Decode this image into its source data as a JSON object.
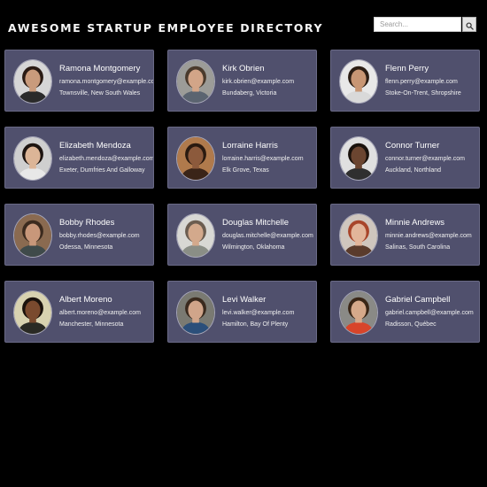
{
  "header": {
    "title": "Awesome Startup Employee Directory"
  },
  "search": {
    "placeholder": "Search...",
    "value": "",
    "icon": "search-icon"
  },
  "employees": [
    {
      "name": "Ramona Montgomery",
      "email": "ramona.montgomery@example.com",
      "location": "Townsville, New South Wales",
      "skin": "#c99b7c",
      "hair": "#2a1b14",
      "bg": "#d6d6d6",
      "shirt": "#2a2a2a"
    },
    {
      "name": "Kirk Obrien",
      "email": "kirk.obrien@example.com",
      "location": "Bundaberg, Victoria",
      "skin": "#d2a588",
      "hair": "#4a3a2c",
      "bg": "#9c9c98",
      "shirt": "#5b6470"
    },
    {
      "name": "Flenn Perry",
      "email": "flenn.perry@example.com",
      "location": "Stoke-On-Trent, Shropshire",
      "skin": "#c89674",
      "hair": "#2b1d14",
      "bg": "#e8e8e8",
      "shirt": "#d9d9d9"
    },
    {
      "name": "Elizabeth Mendoza",
      "email": "elizabeth.mendoza@example.com",
      "location": "Exeter, Dumfries And Galloway",
      "skin": "#dcb597",
      "hair": "#1d1410",
      "bg": "#cfcfcf",
      "shirt": "#e8e8e8"
    },
    {
      "name": "Lorraine Harris",
      "email": "lorraine.harris@example.com",
      "location": "Elk Grove, Texas",
      "skin": "#8c5a3c",
      "hair": "#2a1a10",
      "bg": "#b07a4c",
      "shirt": "#3a2418"
    },
    {
      "name": "Connor Turner",
      "email": "connor.turner@example.com",
      "location": "Auckland, Northland",
      "skin": "#6b4530",
      "hair": "#1a120c",
      "bg": "#e0e0e0",
      "shirt": "#2f2f2f"
    },
    {
      "name": "Bobby Rhodes",
      "email": "bobby.rhodes@example.com",
      "location": "Odessa, Minnesota",
      "skin": "#c8977a",
      "hair": "#3b2a1e",
      "bg": "#8a6a50",
      "shirt": "#3f4a4a"
    },
    {
      "name": "Douglas Mitchelle",
      "email": "douglas.mitchelle@example.com",
      "location": "Wilmington, Oklahoma",
      "skin": "#d3a98c",
      "hair": "#6b5d50",
      "bg": "#d8d8d4",
      "shirt": "#8a8e86"
    },
    {
      "name": "Minnie Andrews",
      "email": "minnie.andrews@example.com",
      "location": "Salinas, South Carolina",
      "skin": "#e2b59a",
      "hair": "#a8452a",
      "bg": "#cfc6be",
      "shirt": "#5a3b2c"
    },
    {
      "name": "Albert Moreno",
      "email": "albert.moreno@example.com",
      "location": "Manchester, Minnesota",
      "skin": "#7a4a2e",
      "hair": "#1a120c",
      "bg": "#d8d2b0",
      "shirt": "#2a2a24"
    },
    {
      "name": "Levi Walker",
      "email": "levi.walker@example.com",
      "location": "Hamilton, Bay Of Plenty",
      "skin": "#d0a58a",
      "hair": "#3a2a1e",
      "bg": "#7a7a72",
      "shirt": "#2b4f7a"
    },
    {
      "name": "Gabriel Campbell",
      "email": "gabriel.campbell@example.com",
      "location": "Radisson, Québec",
      "skin": "#d6a98a",
      "hair": "#3a2616",
      "bg": "#8a8a86",
      "shirt": "#d8452a"
    }
  ]
}
